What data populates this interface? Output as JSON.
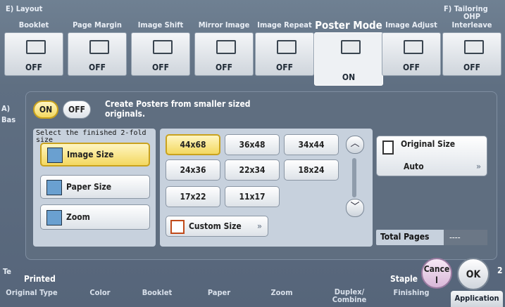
{
  "header": {
    "left_section": "E) Layout",
    "right_section": "F) Tailoring",
    "active_title": "Poster Mode"
  },
  "functions": [
    {
      "label": "Booklet",
      "state": "OFF"
    },
    {
      "label": "Page Margin",
      "state": "OFF"
    },
    {
      "label": "Image Shift",
      "state": "OFF"
    },
    {
      "label": "Mirror Image",
      "state": "OFF"
    },
    {
      "label": "Image Repeat",
      "state": "OFF"
    },
    {
      "label": "Poster Mode",
      "state": "ON"
    },
    {
      "label": "Image Adjust",
      "state": "OFF"
    },
    {
      "label": "OHP Interleave",
      "state": "OFF"
    }
  ],
  "dialog": {
    "on_label": "ON",
    "off_label": "OFF",
    "description": "Create Posters from smaller sized originals.",
    "select_label": "Select the finished 2-fold size",
    "options": [
      "Image Size",
      "Paper Size",
      "Zoom"
    ],
    "sizes": [
      "44x68",
      "36x48",
      "34x44",
      "24x36",
      "22x34",
      "18x24",
      "17x22",
      "11x17"
    ],
    "custom_size": "Custom Size",
    "original_size_label": "Original Size",
    "original_size_value": "Auto",
    "total_pages_label": "Total Pages",
    "total_pages_value": "----",
    "cancel": "Cancel",
    "ok": "OK"
  },
  "side_left": {
    "a": "A)",
    "b": "Bas",
    "t": "Te"
  },
  "bottom_tabs": [
    "Original Type",
    "Color",
    "Booklet",
    "Paper",
    "Zoom",
    "Duplex/ Combine",
    "Finishing",
    "Application"
  ],
  "bottom_values": {
    "printed": "Printed",
    "staple": "Staple",
    "num": "2"
  }
}
